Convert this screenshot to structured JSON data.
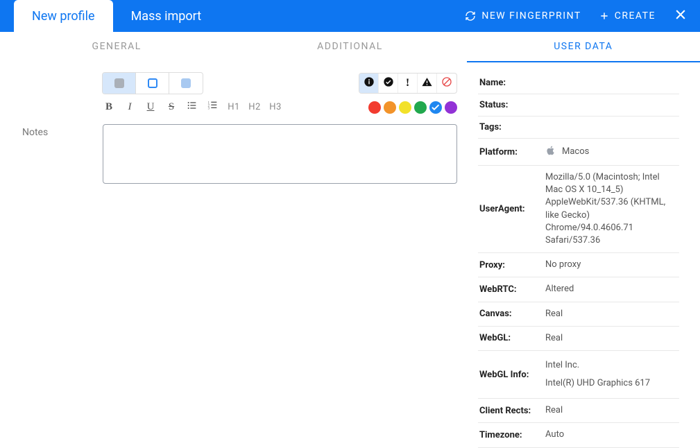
{
  "header": {
    "tabs": [
      {
        "label": "New profile",
        "active": true
      },
      {
        "label": "Mass import",
        "active": false
      }
    ],
    "actions": {
      "new_fingerprint": "NEW FINGERPRINT",
      "create": "CREATE"
    }
  },
  "subtabs": [
    {
      "label": "GENERAL",
      "active": false
    },
    {
      "label": "ADDITIONAL",
      "active": false
    },
    {
      "label": "USER DATA",
      "active": true
    }
  ],
  "editor": {
    "notes_label": "Notes",
    "notes_value": "",
    "headings": [
      "H1",
      "H2",
      "H3"
    ],
    "colors": [
      "#f23b2f",
      "#f2932a",
      "#f2e12a",
      "#21a84d",
      "#1f87f0",
      "#9232d6"
    ],
    "selected_color_index": 4
  },
  "status_icons": [
    "info-icon",
    "check-circle-icon",
    "exclamation-icon",
    "warning-triangle-icon",
    "ban-icon"
  ],
  "userdata": {
    "rows": [
      {
        "key": "Name:",
        "value": ""
      },
      {
        "key": "Status:",
        "value": ""
      },
      {
        "key": "Tags:",
        "value": ""
      },
      {
        "key": "Platform:",
        "value": "Macos",
        "type": "platform"
      },
      {
        "key": "UserAgent:",
        "value": "Mozilla/5.0 (Macintosh; Intel Mac OS X 10_14_5) AppleWebKit/537.36 (KHTML, like Gecko) Chrome/94.0.4606.71 Safari/537.36"
      },
      {
        "key": "Proxy:",
        "value": "No proxy"
      },
      {
        "key": "WebRTC:",
        "value": "Altered"
      },
      {
        "key": "Canvas:",
        "value": "Real"
      },
      {
        "key": "WebGL:",
        "value": "Real"
      },
      {
        "key": "WebGL Info:",
        "value": [
          "Intel Inc.",
          "Intel(R) UHD Graphics 617"
        ],
        "type": "multi"
      },
      {
        "key": "Client Rects:",
        "value": "Real"
      },
      {
        "key": "Timezone:",
        "value": "Auto"
      }
    ]
  }
}
